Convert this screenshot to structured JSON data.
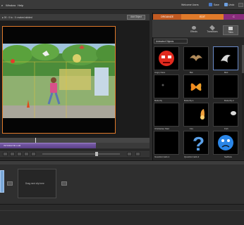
{
  "menu": {
    "items": [
      "e",
      "Window",
      "Help"
    ]
  },
  "topbar": {
    "welcome_label": "Welcome Users",
    "save_label": "Save",
    "undo_label": "Undo",
    "colors": {
      "background": "#3a3a3a",
      "accent": "#e07a2a"
    }
  },
  "monitor": {
    "info_text": "▸ 00 : 0 to : 0: maked aldded",
    "add_button": "Add Object"
  },
  "timeline": {
    "clip_label": "INTOIDAY00 LAM",
    "clip_color": "#7a5ea8"
  },
  "right_panel": {
    "tabs": [
      {
        "label": "ORGANIZE",
        "color": "#c25a21"
      },
      {
        "label": "EDIT",
        "color": "#e07a2a"
      },
      {
        "label": "C",
        "color": "#8a2c7c"
      }
    ],
    "sub_tabs": [
      "Effects",
      "Transitions",
      "Titles"
    ],
    "category": "Animated Objects",
    "items": [
      {
        "label": "Angry Face",
        "icon": "angry-face-icon"
      },
      {
        "label": "Bat",
        "icon": "bat-icon"
      },
      {
        "label": "Bird",
        "icon": "bird-icon"
      },
      {
        "label": "Butterfly",
        "icon": "butterfly-icon"
      },
      {
        "label": "Butterfly-1",
        "icon": "butterfly-orange-icon"
      },
      {
        "label": "Butterfly-2",
        "icon": "butterfly-dark-icon"
      },
      {
        "label": "Chickadee Mad",
        "icon": "chickadee-icon"
      },
      {
        "label": "Fire",
        "icon": "fire-icon"
      },
      {
        "label": "Fish",
        "icon": "fish-icon"
      },
      {
        "label": "Guestionmark-1",
        "icon": "dark-icon"
      },
      {
        "label": "Questionmark-2",
        "icon": "question-mark-icon"
      },
      {
        "label": "Sadface",
        "icon": "sad-face-icon"
      }
    ]
  },
  "sceneline": {
    "drop_text": "Drag next clip here"
  }
}
